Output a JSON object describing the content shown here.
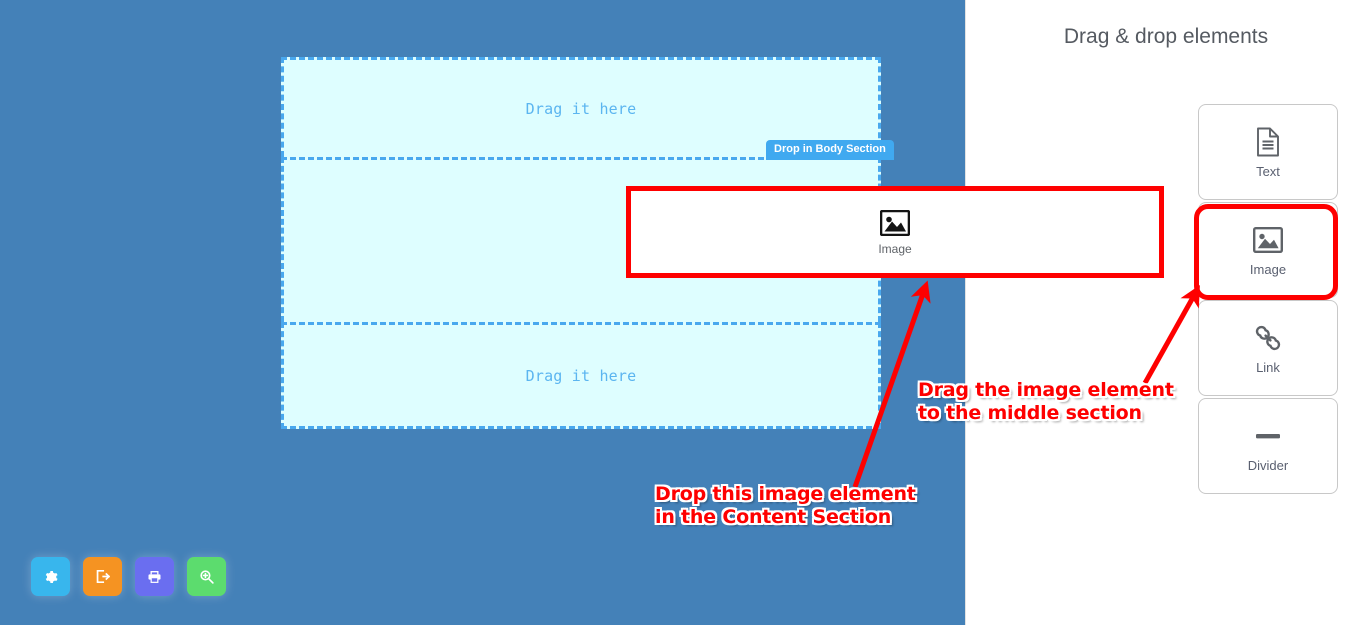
{
  "canvas": {
    "background_color": "#4481b8",
    "sections": [
      {
        "name": "header",
        "hint": "Drag it here"
      },
      {
        "name": "body",
        "hint": ""
      },
      {
        "name": "footer",
        "hint": "Drag it here"
      }
    ],
    "drop_badge": "Drop in Body Section"
  },
  "drag_ghost": {
    "label": "Image"
  },
  "toolbar": {
    "buttons": [
      {
        "name": "settings",
        "icon": "gear-icon",
        "color": "#38b6ed"
      },
      {
        "name": "export",
        "icon": "export-icon",
        "color": "#f59322"
      },
      {
        "name": "print",
        "icon": "printer-icon",
        "color": "#6a6ef0"
      },
      {
        "name": "preview",
        "icon": "zoom-in-icon",
        "color": "#5cdc6e"
      }
    ]
  },
  "sidebar": {
    "title": "Drag & drop elements",
    "items": [
      {
        "label": "Text",
        "icon": "document-icon"
      },
      {
        "label": "Image",
        "icon": "image-icon",
        "highlighted": true
      },
      {
        "label": "Link",
        "icon": "link-icon"
      },
      {
        "label": "Divider",
        "icon": "divider-icon"
      }
    ]
  },
  "annotations": {
    "accent_color": "#fe0000",
    "callout_content": "Drop this image element\nin the Content Section",
    "callout_middle": "Drag the image element\nto the middle section"
  }
}
